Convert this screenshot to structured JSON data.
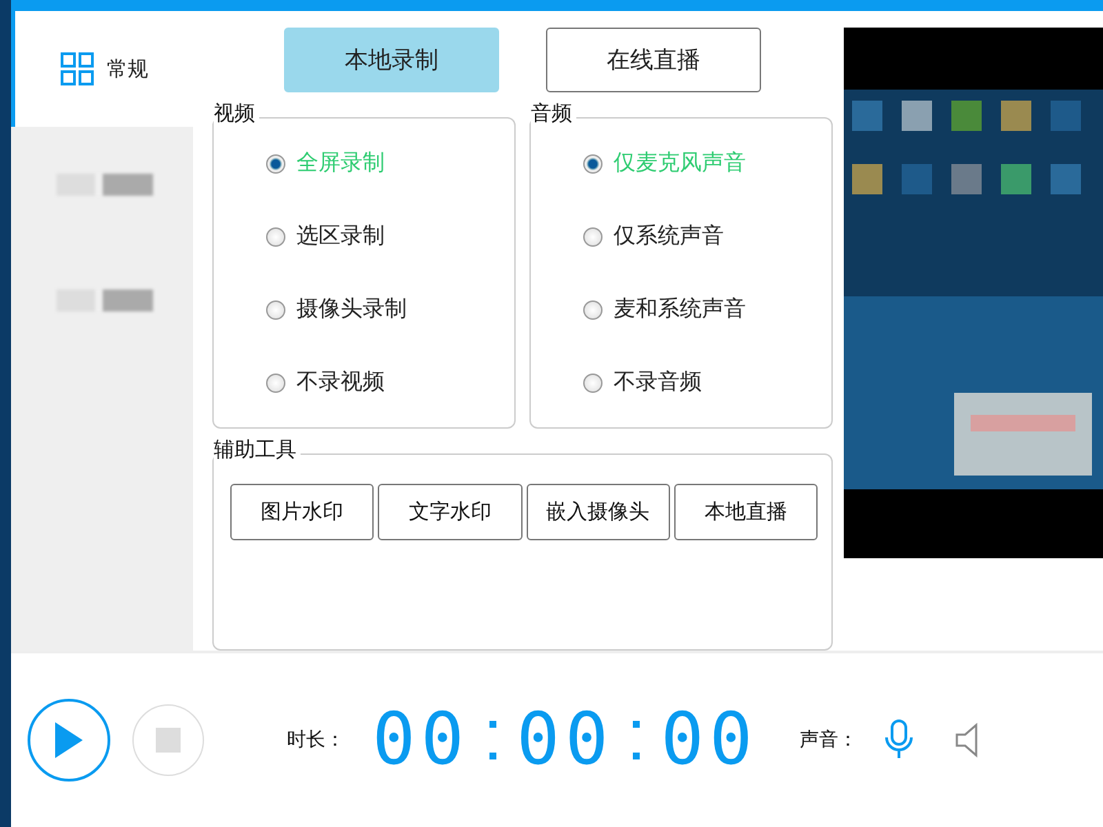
{
  "sidebar": {
    "items": [
      {
        "label": "常规",
        "selected": true,
        "kind": "text"
      },
      {
        "kind": "redacted",
        "selected": false
      },
      {
        "kind": "redacted",
        "selected": false
      }
    ]
  },
  "mode_tabs": [
    {
      "label": "本地录制",
      "selected": true
    },
    {
      "label": "在线直播",
      "selected": false
    }
  ],
  "video": {
    "title": "视频",
    "options": [
      {
        "label": "全屏录制",
        "selected": true
      },
      {
        "label": "选区录制",
        "selected": false
      },
      {
        "label": "摄像头录制",
        "selected": false
      },
      {
        "label": "不录视频",
        "selected": false
      }
    ]
  },
  "audio": {
    "title": "音频",
    "options": [
      {
        "label": "仅麦克风声音",
        "selected": true
      },
      {
        "label": "仅系统声音",
        "selected": false
      },
      {
        "label": "麦和系统声音",
        "selected": false
      },
      {
        "label": "不录音频",
        "selected": false
      }
    ]
  },
  "tools": {
    "title": "辅助工具",
    "buttons": [
      "图片水印",
      "文字水印",
      "嵌入摄像头",
      "本地直播"
    ]
  },
  "footer": {
    "duration_label": "时长：",
    "timer": [
      "00",
      "00",
      "00"
    ],
    "sound_label": "声音："
  }
}
